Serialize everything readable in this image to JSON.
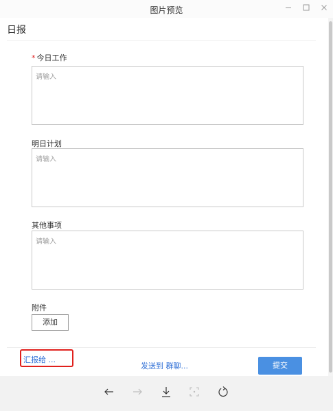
{
  "window": {
    "title": "图片预览",
    "minimize_icon": "minimize-icon",
    "maximize_icon": "maximize-icon",
    "close_icon": "close-icon"
  },
  "form": {
    "title": "日报",
    "today_work": {
      "label": "今日工作",
      "required_mark": "*",
      "placeholder": "请输入"
    },
    "tomorrow_plan": {
      "label": "明日计划",
      "placeholder": "请输入"
    },
    "other_items": {
      "label": "其他事项",
      "placeholder": "请输入"
    },
    "attachments": {
      "label": "附件",
      "add_button": "添加"
    }
  },
  "footer": {
    "report_to": "汇报给 ...",
    "send_to": "发送到 群聊...",
    "submit": "提交"
  },
  "toolbar": {
    "icons": [
      "arrow-left-icon",
      "arrow-right-icon",
      "download-icon",
      "fit-screen-icon",
      "rotate-icon"
    ]
  },
  "colors": {
    "link": "#2f6fd6",
    "primary": "#4a90e2",
    "highlight": "#e0201c",
    "required": "#e02020"
  }
}
